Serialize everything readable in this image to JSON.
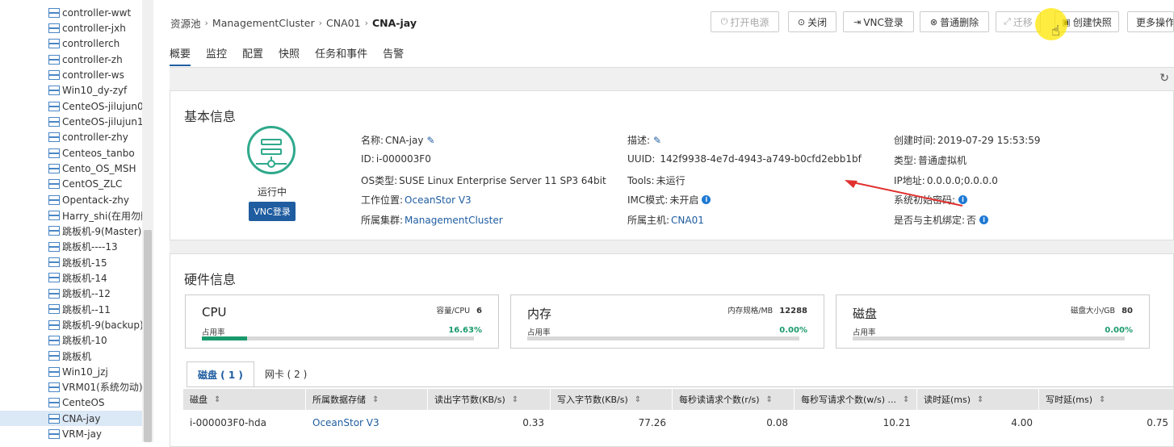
{
  "sidebar": {
    "items": [
      {
        "label": "controller-wwt"
      },
      {
        "label": "controller-jxh"
      },
      {
        "label": "controllerch"
      },
      {
        "label": "controller-zh"
      },
      {
        "label": "controller-ws"
      },
      {
        "label": "Win10_dy-zyf"
      },
      {
        "label": "CenteOS-jilujun0"
      },
      {
        "label": "CenteOS-jilujun1"
      },
      {
        "label": "controller-zhy"
      },
      {
        "label": "Centeos_tanbo"
      },
      {
        "label": "Cento_OS_MSH"
      },
      {
        "label": "CentOS_ZLC"
      },
      {
        "label": "Opentack-zhy"
      },
      {
        "label": "Harry_shi(在用勿删"
      },
      {
        "label": "跳板机-9(Master)"
      },
      {
        "label": "跳板机----13"
      },
      {
        "label": "跳板机-15"
      },
      {
        "label": "跳板机-14"
      },
      {
        "label": "跳板机--12"
      },
      {
        "label": "跳板机--11"
      },
      {
        "label": "跳板机-9(backup)"
      },
      {
        "label": "跳板机-10"
      },
      {
        "label": "跳板机"
      },
      {
        "label": "Win10_jzj"
      },
      {
        "label": "VRM01(系统勿动)"
      },
      {
        "label": "CenteOS"
      },
      {
        "label": "CNA-jay",
        "selected": true
      },
      {
        "label": "VRM-jay"
      }
    ]
  },
  "breadcrumb": {
    "items": [
      "资源池",
      "ManagementCluster",
      "CNA01"
    ],
    "current": "CNA-jay"
  },
  "tabs": [
    "概要",
    "监控",
    "配置",
    "快照",
    "任务和事件",
    "告警"
  ],
  "toolbar": {
    "power_on": "打开电源",
    "shutdown": "关闭",
    "vnc_login": "VNC登录",
    "delete": "普通删除",
    "migrate": "迁移",
    "snapshot": "创建快照",
    "more": "更多操作"
  },
  "basic": {
    "title": "基本信息",
    "status": "运行中",
    "vnc_button": "VNC登录",
    "name_label": "名称:",
    "name_value": "CNA-jay",
    "id_label": "ID:",
    "id_value": "i-000003F0",
    "os_label": "OS类型:",
    "os_value": "SUSE Linux Enterprise Server 11 SP3 64bit",
    "location_label": "工作位置:",
    "location_value": "OceanStor V3",
    "cluster_label": "所属集群:",
    "cluster_value": "ManagementCluster",
    "desc_label": "描述:",
    "uuid_label": "UUID:",
    "uuid_value": "142f9938-4e7d-4943-a749-b0cfd2ebb1bf",
    "tools_label": "Tools:",
    "tools_value": "未运行",
    "imc_label": "IMC模式:",
    "imc_value": "未开启",
    "host_label": "所属主机:",
    "host_value": "CNA01",
    "created_label": "创建时间:",
    "created_value": "2019-07-29 15:53:59",
    "type_label": "类型:",
    "type_value": "普通虚拟机",
    "ip_label": "IP地址:",
    "ip_value": "0.0.0.0;0.0.0.0",
    "initpwd_label": "系统初始密码:",
    "binding_label": "是否与主机绑定:",
    "binding_value": "否"
  },
  "hardware": {
    "title": "硬件信息",
    "cards": [
      {
        "name": "CPU",
        "cap_label": "容量/CPU",
        "cap_value": "6",
        "usage_label": "占用率",
        "usage_value": "16.63%",
        "usage_fraction": 0.1663
      },
      {
        "name": "内存",
        "cap_label": "内存规格/MB",
        "cap_value": "12288",
        "usage_label": "占用率",
        "usage_value": "0.00%",
        "usage_fraction": 0
      },
      {
        "name": "磁盘",
        "cap_label": "磁盘大小/GB",
        "cap_value": "80",
        "usage_label": "占用率",
        "usage_value": "0.00%",
        "usage_fraction": 0
      }
    ],
    "subtabs": [
      "磁盘 ( 1 )",
      "网卡 ( 2 )"
    ],
    "table": {
      "headers": [
        "磁盘",
        "所属数据存储",
        "读出字节数(KB/s)",
        "写入字节数(KB/s)",
        "每秒读请求个数(r/s)",
        "每秒写请求个数(w/s) ...",
        "读时延(ms)",
        "写时延(ms)"
      ],
      "rows": [
        [
          "i-000003F0-hda",
          "OceanStor V3",
          "0.33",
          "77.26",
          "0.08",
          "10.21",
          "4.00",
          "0.75"
        ]
      ]
    }
  },
  "colors": {
    "accent": "#1f5da0",
    "green": "#1a9a6c",
    "annotation_arrow": "#e0312f"
  }
}
